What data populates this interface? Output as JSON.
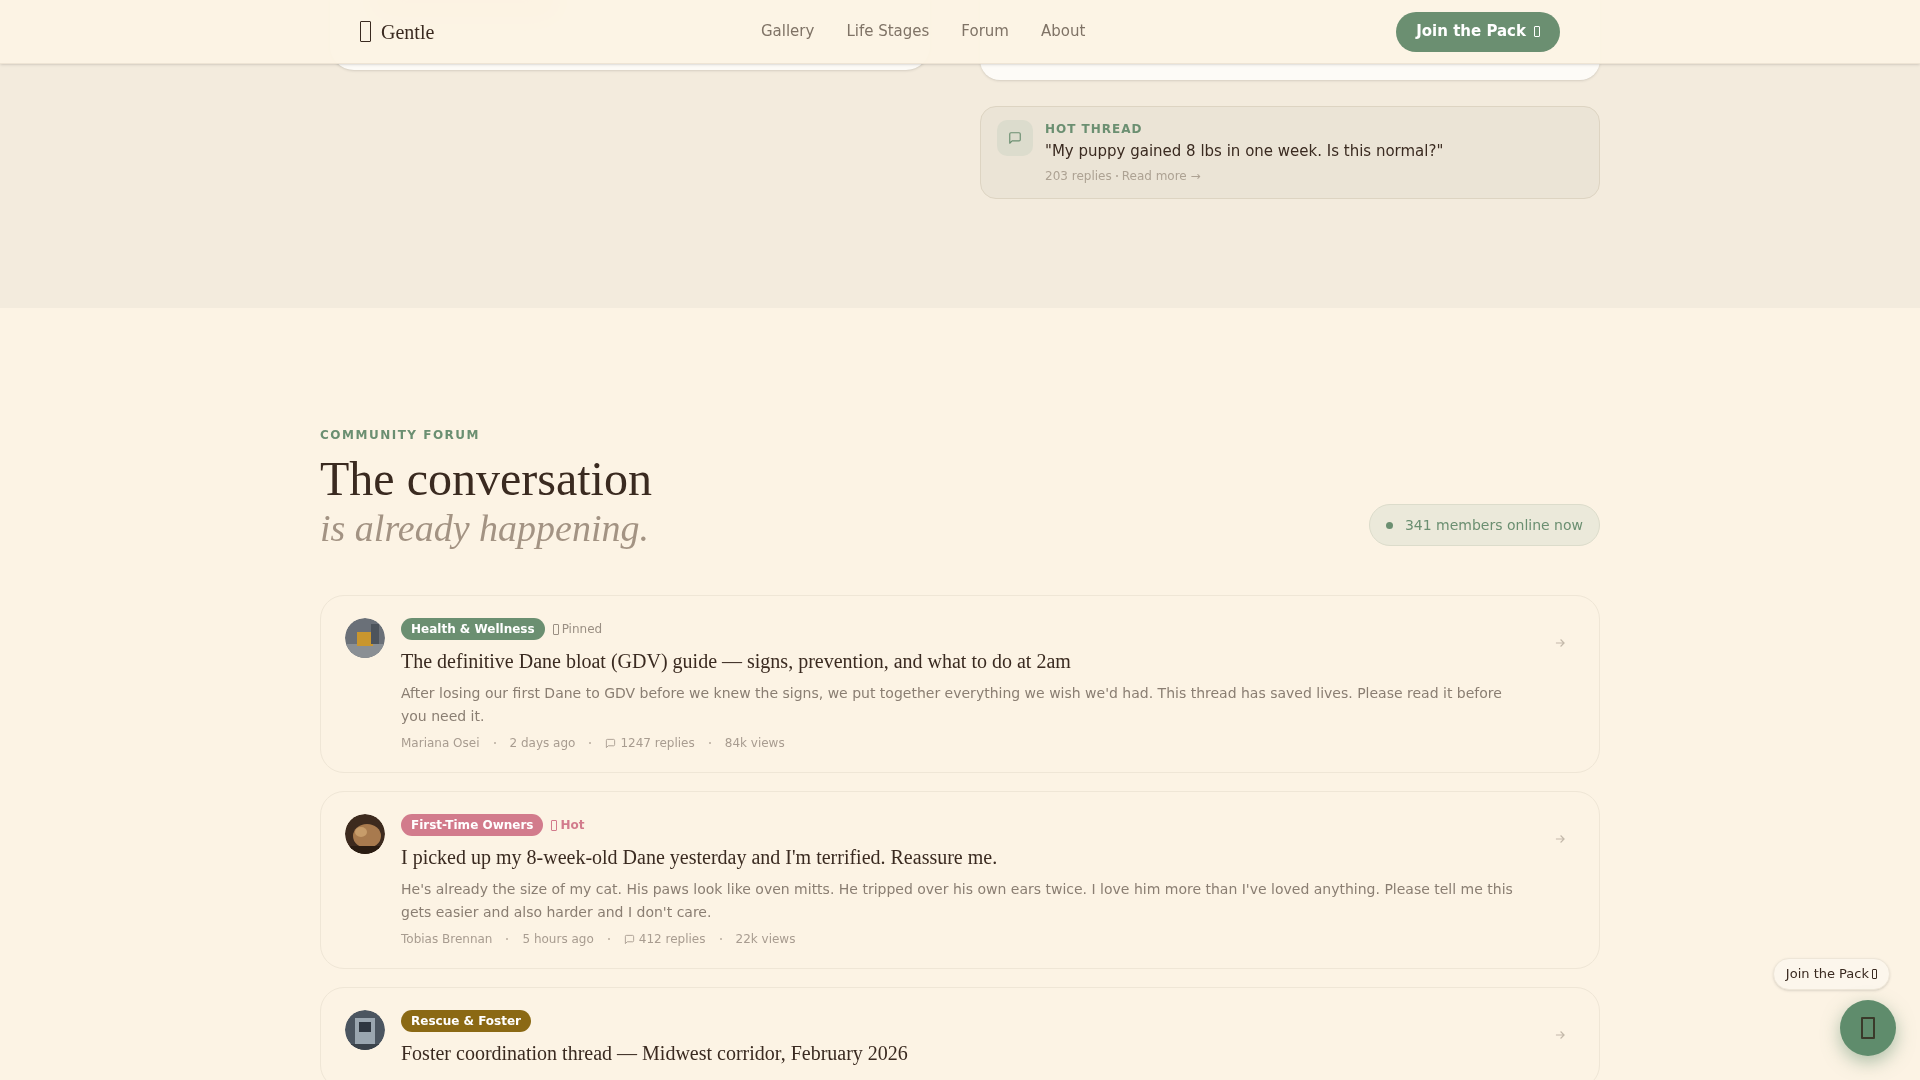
{
  "nav": {
    "logo": "Gentle",
    "links": [
      {
        "label": "Gallery"
      },
      {
        "label": "Life Stages"
      },
      {
        "label": "Forum"
      },
      {
        "label": "About"
      }
    ],
    "cta": "Join the Pack"
  },
  "hot_thread": {
    "label": "HOT THREAD",
    "title": "\"My puppy gained 8 lbs in one week. Is this normal?\"",
    "replies": "203 replies",
    "link": "Read more →"
  },
  "forum": {
    "eyebrow": "COMMUNITY FORUM",
    "heading": "The conversation",
    "subheading": "is already happening.",
    "online": "341 members online now",
    "posts": [
      {
        "tag": "Health & Wellness",
        "color": "#6b8f71",
        "flag": {
          "kind": "pinned",
          "label": "Pinned"
        },
        "title": "The definitive Dane bloat (GDV) guide — signs, prevention, and what to do at 2am",
        "body": "After losing our first Dane to GDV before we knew the signs, we put together everything we wish we'd had. This thread has saved lives. Please read it before you need it.",
        "author": "Mariana Osei",
        "time": "2 days ago",
        "replies": "1247 replies",
        "views": "84k views"
      },
      {
        "tag": "First-Time Owners",
        "color": "#d27b8c",
        "flag": {
          "kind": "hot",
          "label": "Hot"
        },
        "title": "I picked up my 8-week-old Dane yesterday and I'm terrified. Reassure me.",
        "body": "He's already the size of my cat. His paws look like oven mitts. He tripped over his own ears twice. I love him more than I've loved anything. Please tell me this gets easier and also harder and I don't care.",
        "author": "Tobias Brennan",
        "time": "5 hours ago",
        "replies": "412 replies",
        "views": "22k views"
      },
      {
        "tag": "Rescue & Foster",
        "color": "#8b6914",
        "title": "Foster coordination thread — Midwest corridor, February 2026"
      }
    ]
  },
  "floating": {
    "tooltip": "Join the Pack"
  }
}
